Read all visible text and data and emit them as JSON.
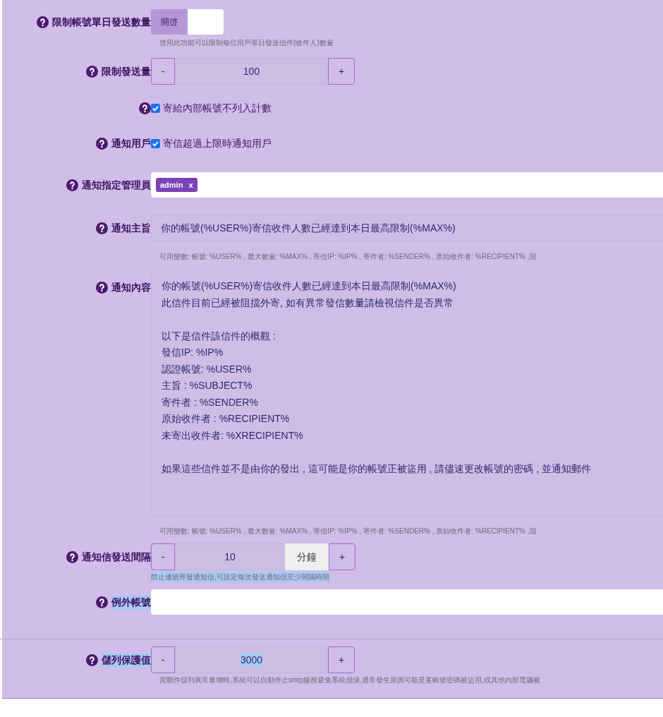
{
  "fields": [
    {
      "kind": "toggle",
      "label": "限制帳號單日發送數量",
      "toggle": {
        "text": "開啓",
        "on": true
      },
      "hint": "啓用此功能可以限制每位用戶單日發送信件(收件人)數量"
    },
    {
      "kind": "stepper",
      "label": "限制發送量",
      "minus": "-",
      "value": "100",
      "plus": "+"
    },
    {
      "kind": "checkbox",
      "text": "寄給內部帳號不列入計數",
      "checked": true
    },
    {
      "kind": "checkbox",
      "label": "通知用戶",
      "text": "寄信超過上限時通知用戶",
      "checked": true
    },
    {
      "kind": "tags",
      "label": "通知指定管理員",
      "tags": [
        {
          "text": "admin",
          "remove": "x"
        }
      ]
    },
    {
      "kind": "text",
      "label": "通知主旨",
      "value": "你的帳號(%USER%)寄信收件人數已經達到本日最高限制(%MAX%)",
      "hint": "可用變數: 帳號: %USER% , 最大數量: %MAX% , 寄信IP: %IP% , 寄件者: %SENDER% , 原始收件者: %RECIPIENT% ,阻"
    },
    {
      "kind": "textarea",
      "label": "通知內容",
      "paragraphs": [
        [
          "你的帳號(%USER%)寄信收件人數已經達到本日最高限制(%MAX%)",
          "此信件目前已經被阻擋外寄, 如有異常發信數量請檢視信件是否異常"
        ],
        [
          "以下是信件該信件的概觀 :",
          "發信IP: %IP%",
          "認證帳號: %USER%",
          "主旨 : %SUBJECT%",
          "寄件者 : %SENDER%",
          "原始收件者 : %RECIPIENT%",
          "未寄出收件者: %XRECIPIENT%"
        ],
        [
          "如果這些信件並不是由你的發出 , 這可能是你的帳號正被盜用 , 請儘速更改帳號的密碼 , 並通知郵件"
        ]
      ],
      "hint": "可用變數: 帳號: %USER% , 最大數量: %MAX% , 寄信IP: %IP% , 寄件者: %SENDER% , 原始收件者: %RECIPIENT% ,阻"
    },
    {
      "kind": "stepper",
      "label": "通知信發送間隔",
      "minus": "-",
      "value": "10",
      "unit": "分鐘",
      "plus": "+",
      "hint": "防止連續寄發通知信,可設定每次發送通知信至少間隔時間",
      "hint_highlighted": true
    },
    {
      "kind": "input",
      "label": "例外帳號",
      "label_highlighted": true
    },
    {
      "kind": "divider"
    },
    {
      "kind": "stepper",
      "label": "儲列保護值",
      "label_highlighted": true,
      "minus": "-",
      "value": "3000",
      "value_highlighted": true,
      "plus": "+",
      "hint": "當郵件儲列異常暴增時,系統可以自動停止smtp服務避免系統崩潰,通常發生原因可能是某帳號密碼被盜用,或其他內部電腦被"
    }
  ]
}
